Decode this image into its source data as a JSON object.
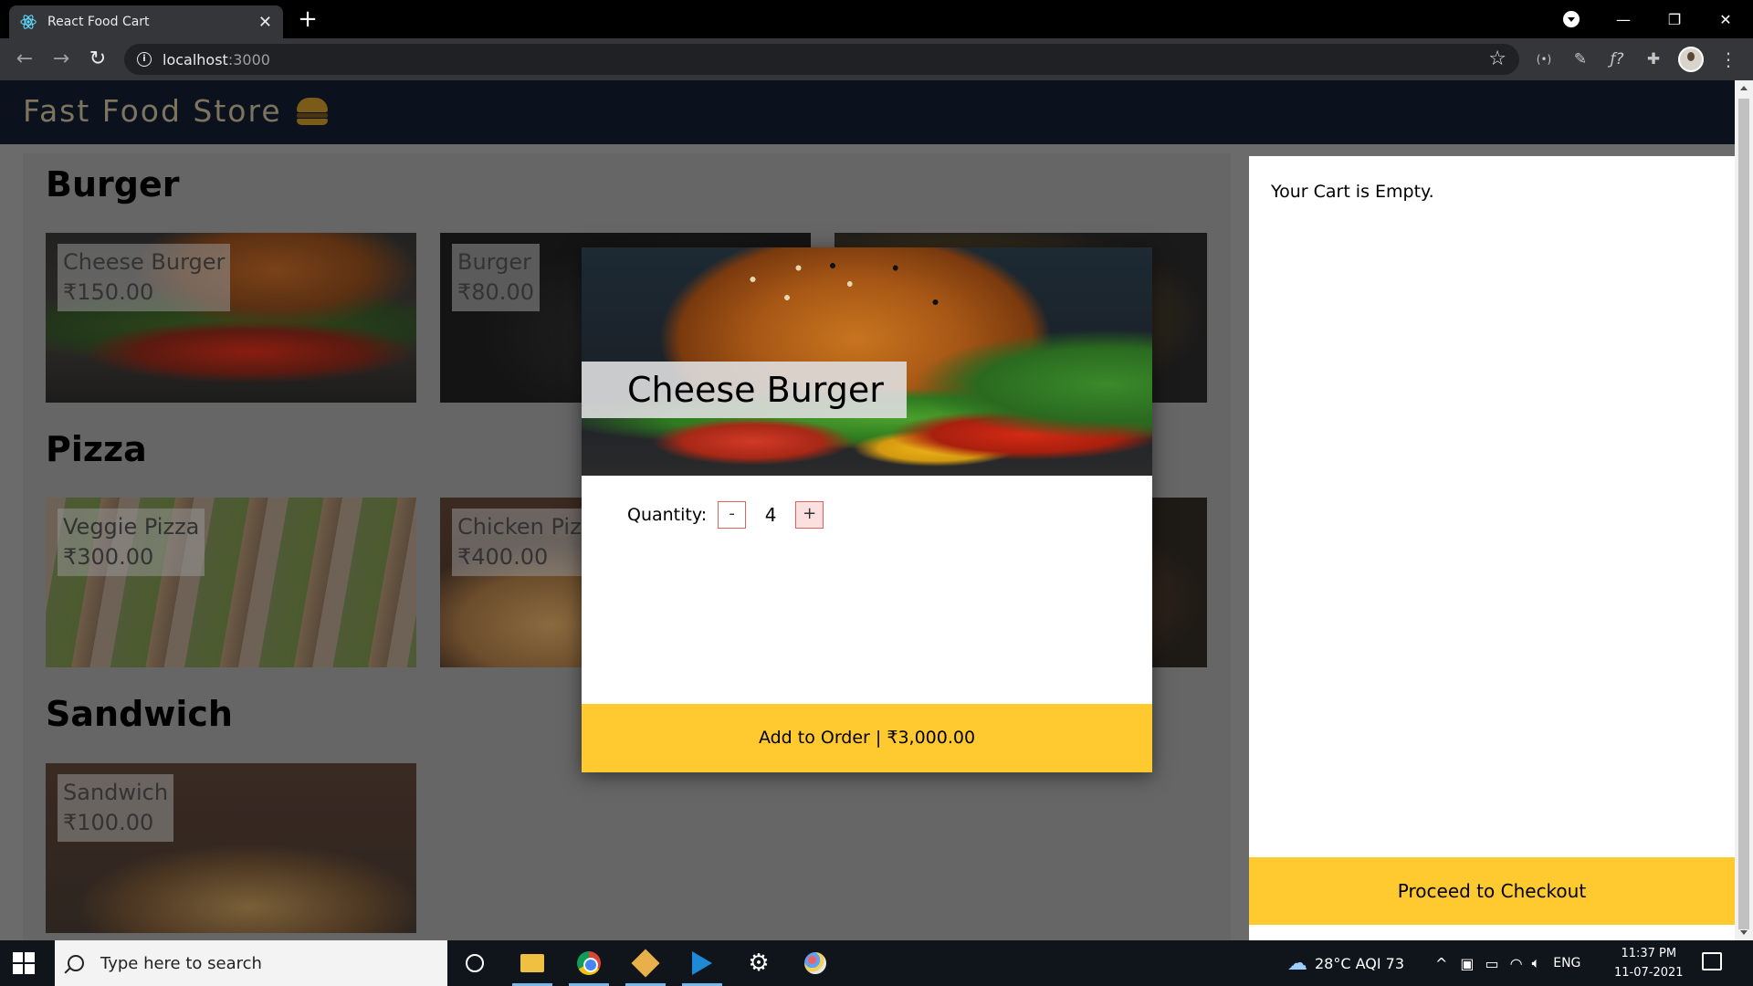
{
  "browser": {
    "tab_title": "React Food Cart",
    "tab_close": "✕",
    "new_tab": "+",
    "url_host": "localhost",
    "url_port": ":3000",
    "window_controls": {
      "minimize": "—",
      "restore": "❐",
      "close": "✕"
    }
  },
  "site": {
    "brand": "Fast Food Store"
  },
  "menu": {
    "categories": [
      {
        "title": "Burger",
        "items": [
          {
            "name": "Cheese Burger",
            "price": "₹150.00"
          },
          {
            "name": "Burger",
            "price": "₹80.00"
          }
        ]
      },
      {
        "title": "Pizza",
        "items": [
          {
            "name": "Veggie Pizza",
            "price": "₹300.00"
          },
          {
            "name": "Chicken Pizza",
            "price": "₹400.00"
          }
        ]
      },
      {
        "title": "Sandwich",
        "items": [
          {
            "name": "Sandwich",
            "price": "₹100.00"
          }
        ]
      }
    ]
  },
  "modal": {
    "title": "Cheese Burger",
    "quantity_label": "Quantity:",
    "decrement": "-",
    "quantity": "4",
    "increment": "+",
    "add_button": "Add to Order | ₹3,000.00"
  },
  "cart": {
    "empty_message": "Your Cart is Empty.",
    "checkout_button": "Proceed to Checkout"
  },
  "taskbar": {
    "search_placeholder": "Type here to search",
    "weather": "28°C  AQI 73",
    "language": "ENG",
    "time": "11:37 PM",
    "date": "11-07-2021"
  },
  "colors": {
    "accent_yellow": "#ffc930",
    "header_bg": "#0b111d",
    "overlay_bg": "#6b6b6b"
  }
}
